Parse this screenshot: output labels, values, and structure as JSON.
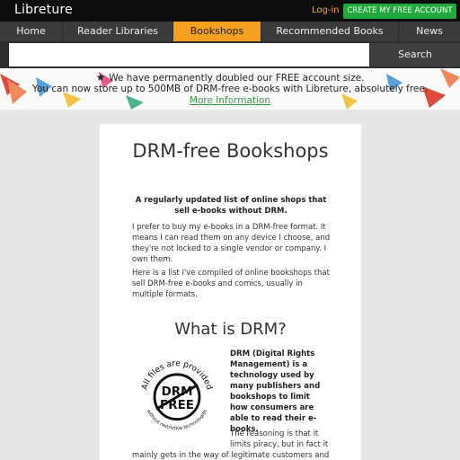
{
  "header": {
    "logo": "Libreture",
    "login": "Log-in",
    "create_account": "CREATE MY FREE ACCOUNT"
  },
  "nav": {
    "items": [
      {
        "label": "Home",
        "active": false
      },
      {
        "label": "Reader Libraries",
        "active": false
      },
      {
        "label": "Bookshops",
        "active": true
      },
      {
        "label": "Recommended Books",
        "active": false
      },
      {
        "label": "News",
        "active": false
      }
    ]
  },
  "search": {
    "placeholder": "",
    "button": "Search"
  },
  "banner": {
    "line1": "We have permanently doubled our FREE account size.",
    "line2": "You can now store up to 500MB of DRM-free e-books with Libreture, absolutely free.",
    "link": "More Information"
  },
  "content": {
    "title": "DRM-free Bookshops",
    "lede": "A regularly updated list of online shops that sell e-books without DRM.",
    "p1": "I prefer to buy my e-books in a DRM-free format. It means I can read them on any device I choose, and they're not locked to a single vendor or company. I own them.",
    "p2": "Here is a list I've compiled of online bookshops that sell DRM-free e-books and comics, usually in multiple formats.",
    "h2": "What is DRM?",
    "drm_def": "DRM (Digital Rights Management) is a technology used by many publishers and bookshops to limit how consumers are able to read their e-books.",
    "reasoning": "The reasoning is that it limits piracy, but in fact it",
    "reasoning_cont": "mainly gets in the way of legitimate customers and"
  },
  "badge": {
    "top_text": "All files are provided",
    "line1": "DRM",
    "line2": "FREE",
    "bottom_text": "without restrictive technologies"
  },
  "colors": {
    "accent_orange": "#f5a01e",
    "brand_green": "#22a83c",
    "login_orange": "#f5a623",
    "link_green": "#3a9a44"
  }
}
